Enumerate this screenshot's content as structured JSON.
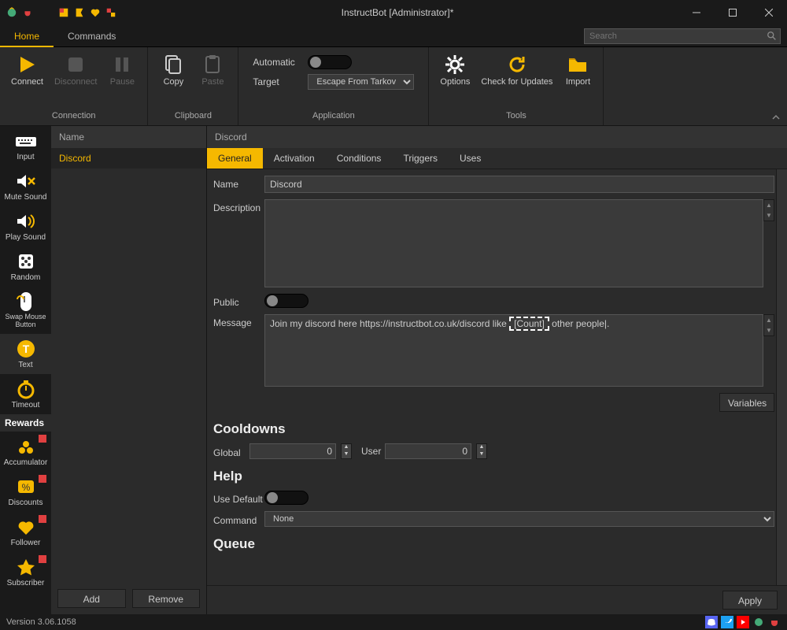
{
  "window": {
    "title": "InstructBot [Administrator]*",
    "minimize": "–",
    "maximize": "☐",
    "close": "✕"
  },
  "menubar": {
    "tabs": [
      "Home",
      "Commands"
    ],
    "active": 0,
    "search_placeholder": "Search"
  },
  "ribbon": {
    "connection": {
      "label": "Connection",
      "connect": "Connect",
      "disconnect": "Disconnect",
      "pause": "Pause"
    },
    "clipboard": {
      "label": "Clipboard",
      "copy": "Copy",
      "paste": "Paste"
    },
    "application": {
      "label": "Application",
      "automatic": "Automatic",
      "target": "Target",
      "target_value": "Escape From Tarkov"
    },
    "tools": {
      "label": "Tools",
      "options": "Options",
      "check_updates": "Check for Updates",
      "import": "Import"
    }
  },
  "sidebar": {
    "items": [
      {
        "label": "Input"
      },
      {
        "label": "Mute Sound"
      },
      {
        "label": "Play Sound"
      },
      {
        "label": "Random"
      },
      {
        "label": "Swap Mouse Button"
      },
      {
        "label": "Text",
        "active": true
      },
      {
        "label": "Timeout"
      }
    ],
    "rewards_heading": "Rewards",
    "rewards": [
      {
        "label": "Accumulator"
      },
      {
        "label": "Discounts"
      },
      {
        "label": "Follower"
      },
      {
        "label": "Subscriber"
      }
    ]
  },
  "namecol": {
    "header": "Name",
    "items": [
      "Discord"
    ],
    "add": "Add",
    "remove": "Remove"
  },
  "editor": {
    "header": "Discord",
    "tabs": [
      "General",
      "Activation",
      "Conditions",
      "Triggers",
      "Uses"
    ],
    "active_tab": 0,
    "fields": {
      "name_label": "Name",
      "name_value": "Discord",
      "description_label": "Description",
      "description_value": "",
      "public_label": "Public",
      "message_label": "Message",
      "message_value_pre": "Join my discord here https://instructbot.co.uk/discord like ",
      "message_token": "[Count]",
      "message_value_post": " other people|."
    },
    "variables_btn": "Variables",
    "cooldowns": {
      "heading": "Cooldowns",
      "global_label": "Global",
      "global_value": "0",
      "user_label": "User",
      "user_value": "0"
    },
    "help": {
      "heading": "Help",
      "use_default_label": "Use Default",
      "command_label": "Command",
      "command_value": "None"
    },
    "queue": {
      "heading": "Queue"
    },
    "apply": "Apply"
  },
  "status": {
    "version": "Version 3.06.1058"
  }
}
